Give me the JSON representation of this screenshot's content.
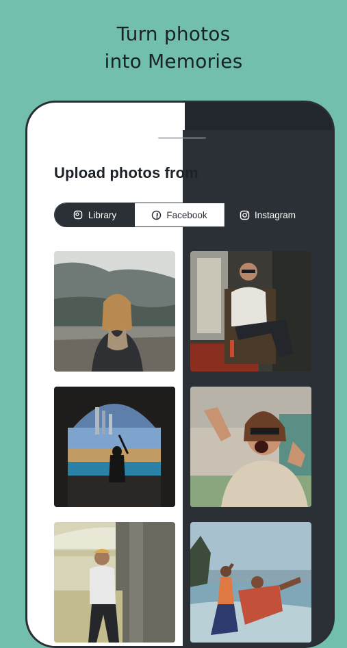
{
  "headline": {
    "line1": "Turn photos",
    "line2": "into Memories"
  },
  "sheet": {
    "title": "Upload photos from"
  },
  "tabs": [
    {
      "label": "Library",
      "icon": "library-icon"
    },
    {
      "label": "Facebook",
      "icon": "facebook-icon"
    },
    {
      "label": "Instagram",
      "icon": "instagram-icon"
    }
  ],
  "photos": [
    {
      "name": "photo-woman-scarf-mountains"
    },
    {
      "name": "photo-man-sunglasses-chair"
    },
    {
      "name": "photo-tunnel-silhouette-coast"
    },
    {
      "name": "photo-woman-peace-signs"
    },
    {
      "name": "photo-man-cap-building"
    },
    {
      "name": "photo-dancing-beach"
    }
  ],
  "colors": {
    "background": "#72bfae",
    "dark": "#2b2f36",
    "light": "#ffffff",
    "text": "#182326"
  }
}
